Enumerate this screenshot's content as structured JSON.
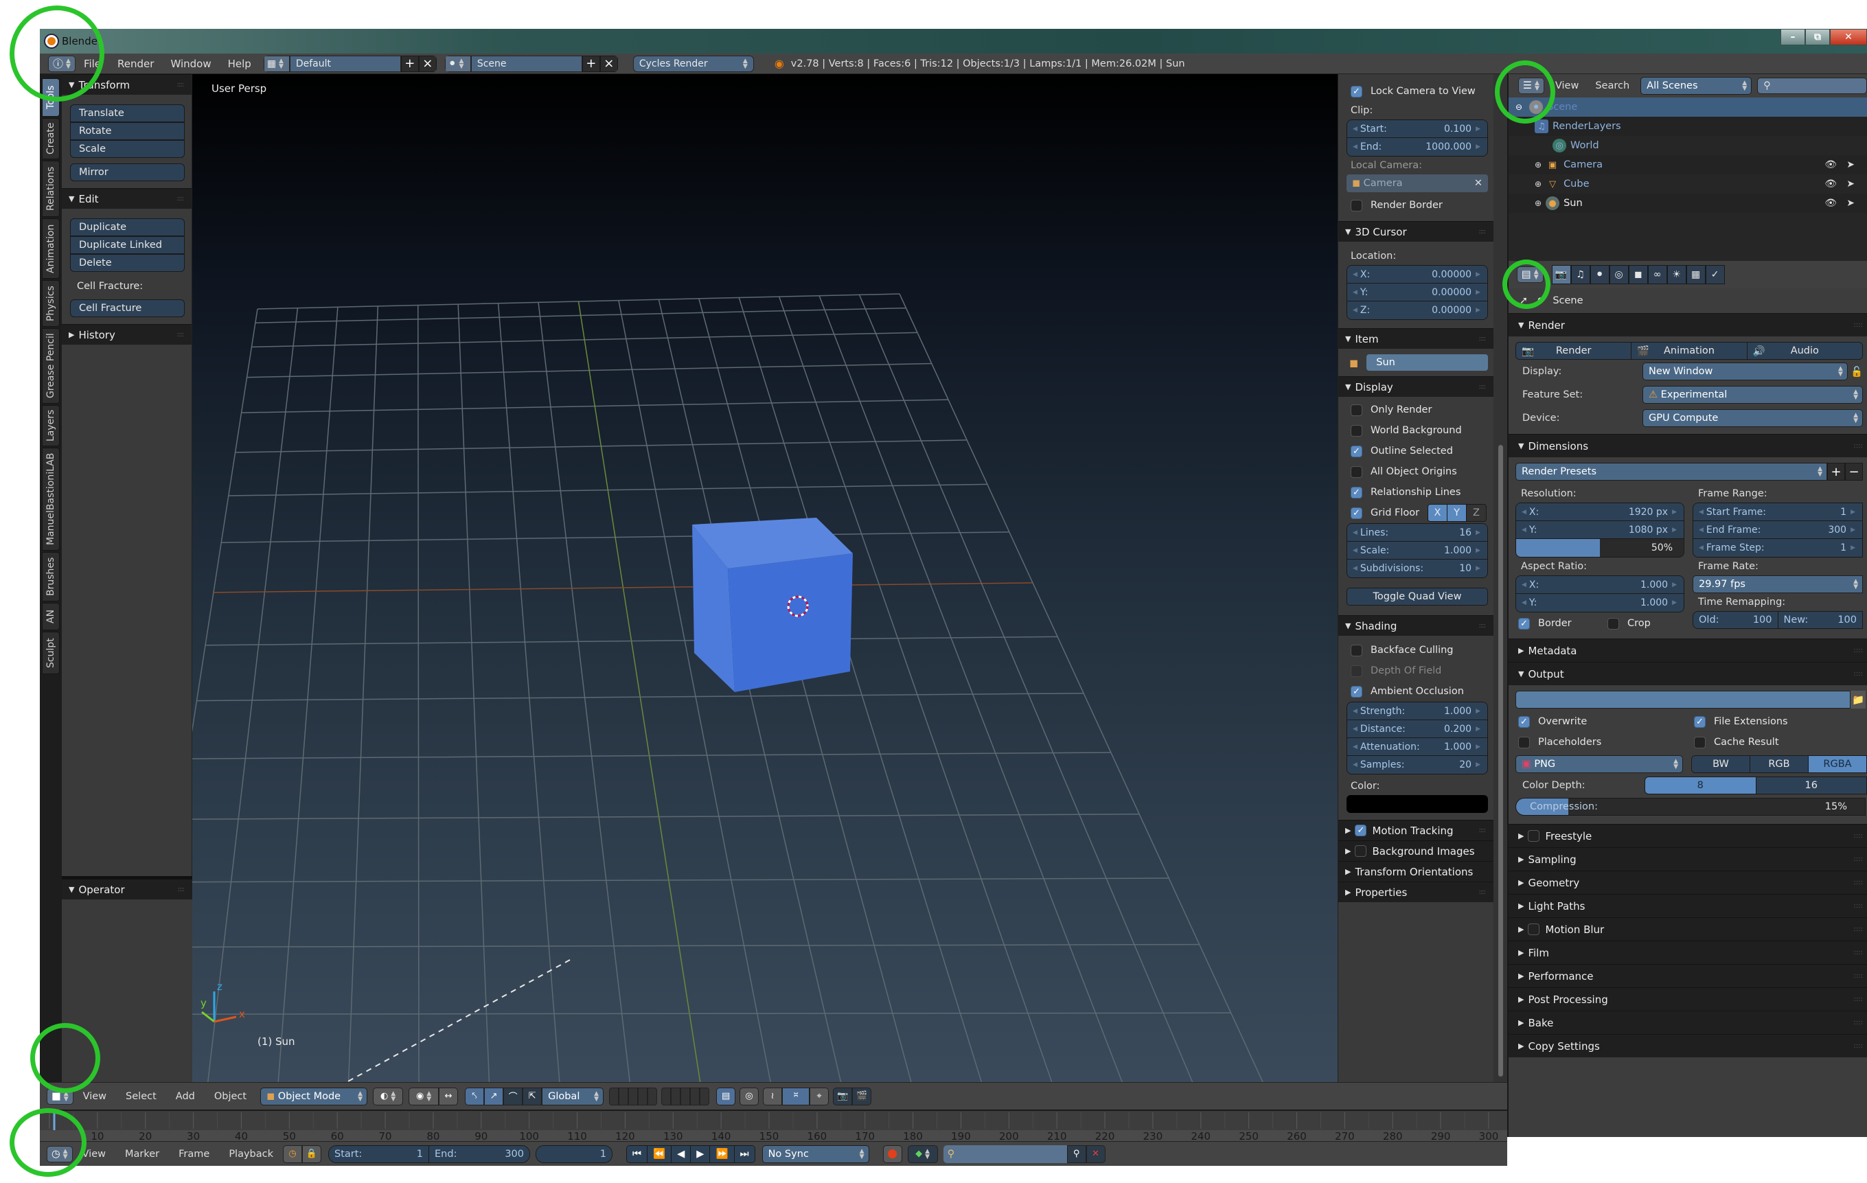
{
  "window": {
    "title": "Blender",
    "controls": [
      "minimize",
      "restore",
      "close"
    ]
  },
  "menubar": {
    "editor_type_icon": "info-icon",
    "menus": [
      "File",
      "Render",
      "Window",
      "Help"
    ],
    "screen_layout": "Default",
    "scene": "Scene",
    "render_engine": "Cycles Render",
    "stats": "v2.78 | Verts:8 | Faces:6 | Tris:12 | Objects:1/3 | Lamps:1/1 | Mem:26.02M | Sun"
  },
  "left_tabs": [
    "Tools",
    "Create",
    "Relations",
    "Animation",
    "Physics",
    "Grease Pencil",
    "Layers",
    "ManuelBastioniLAB",
    "Brushes",
    "AN",
    "Sculpt"
  ],
  "toolbar": {
    "transform": {
      "title": "Transform",
      "buttons": [
        "Translate",
        "Rotate",
        "Scale"
      ],
      "mirror": "Mirror"
    },
    "edit": {
      "title": "Edit",
      "buttons": [
        "Duplicate",
        "Duplicate Linked",
        "Delete"
      ],
      "cell_fracture_label": "Cell Fracture:",
      "cell_fracture_button": "Cell Fracture"
    },
    "history": {
      "title": "History"
    },
    "operator": {
      "title": "Operator"
    }
  },
  "viewport": {
    "view_label": "User Persp",
    "active_object": "(1) Sun",
    "axis_labels": {
      "x": "x",
      "y": "y",
      "z": "z"
    },
    "cube_color": "#4a74d8"
  },
  "npanel": {
    "view": {
      "lock_camera": {
        "label": "Lock Camera to View",
        "checked": true
      },
      "clip_label": "Clip:",
      "clip_start": {
        "label": "Start:",
        "value": "0.100"
      },
      "clip_end": {
        "label": "End:",
        "value": "1000.000"
      },
      "local_camera_label": "Local Camera:",
      "local_camera_value": "Camera",
      "render_border": {
        "label": "Render Border",
        "checked": false
      }
    },
    "cursor": {
      "title": "3D Cursor",
      "location_label": "Location:",
      "x": {
        "label": "X:",
        "value": "0.00000"
      },
      "y": {
        "label": "Y:",
        "value": "0.00000"
      },
      "z": {
        "label": "Z:",
        "value": "0.00000"
      }
    },
    "item": {
      "title": "Item",
      "name": "Sun"
    },
    "display": {
      "title": "Display",
      "only_render": {
        "label": "Only Render",
        "checked": false
      },
      "world_background": {
        "label": "World Background",
        "checked": false
      },
      "outline_selected": {
        "label": "Outline Selected",
        "checked": true
      },
      "all_object_origins": {
        "label": "All Object Origins",
        "checked": false
      },
      "relationship_lines": {
        "label": "Relationship Lines",
        "checked": true
      },
      "grid_floor": {
        "label": "Grid Floor",
        "checked": true,
        "axes": [
          "X",
          "Y",
          "Z"
        ],
        "axes_on": [
          true,
          true,
          false
        ]
      },
      "lines": {
        "label": "Lines:",
        "value": "16"
      },
      "scale": {
        "label": "Scale:",
        "value": "1.000"
      },
      "subdivisions": {
        "label": "Subdivisions:",
        "value": "10"
      },
      "toggle_quad": "Toggle Quad View"
    },
    "shading": {
      "title": "Shading",
      "backface_culling": {
        "label": "Backface Culling",
        "checked": false
      },
      "depth_of_field": {
        "label": "Depth Of Field",
        "checked": false
      },
      "ambient_occlusion": {
        "label": "Ambient Occlusion",
        "checked": true
      },
      "strength": {
        "label": "Strength:",
        "value": "1.000"
      },
      "distance": {
        "label": "Distance:",
        "value": "0.200"
      },
      "attenuation": {
        "label": "Attenuation:",
        "value": "1.000"
      },
      "samples": {
        "label": "Samples:",
        "value": "20"
      },
      "color_label": "Color:",
      "color_value": "#000000"
    },
    "collapsed": [
      {
        "label": "Motion Tracking",
        "checkbox": true,
        "checked": true
      },
      {
        "label": "Background Images",
        "checkbox": true,
        "checked": false
      },
      {
        "label": "Transform Orientations",
        "checkbox": false
      },
      {
        "label": "Properties",
        "checkbox": false
      }
    ]
  },
  "outliner": {
    "menus": [
      "View",
      "Search"
    ],
    "filter": "All Scenes",
    "search_placeholder": "",
    "tree": [
      {
        "name": "Scene",
        "icon": "scene-icon",
        "level": 0,
        "selected": true
      },
      {
        "name": "RenderLayers",
        "icon": "render-layers-icon",
        "level": 1
      },
      {
        "name": "World",
        "icon": "world-icon",
        "level": 1
      },
      {
        "name": "Camera",
        "icon": "camera-icon",
        "level": 1,
        "visible": true
      },
      {
        "name": "Cube",
        "icon": "mesh-icon",
        "level": 1,
        "visible": true
      },
      {
        "name": "Sun",
        "icon": "lamp-icon",
        "level": 1,
        "visible": true
      }
    ]
  },
  "properties": {
    "tabs": [
      "render-icon",
      "render-layers-icon",
      "scene-icon",
      "world-icon",
      "object-icon",
      "constraints-icon",
      "data-icon",
      "texture-icon",
      "modifiers-icon"
    ],
    "context": "Scene",
    "render": {
      "title": "Render",
      "buttons": [
        "Render",
        "Animation",
        "Audio"
      ],
      "display_label": "Display:",
      "display_value": "New Window",
      "feature_set_label": "Feature Set:",
      "feature_set_value": "Experimental",
      "device_label": "Device:",
      "device_value": "GPU Compute"
    },
    "dimensions": {
      "title": "Dimensions",
      "presets": "Render Presets",
      "resolution_label": "Resolution:",
      "res_x": {
        "label": "X:",
        "value": "1920 px"
      },
      "res_y": {
        "label": "Y:",
        "value": "1080 px"
      },
      "res_pct": {
        "value": "50%",
        "fraction": 0.5
      },
      "aspect_label": "Aspect Ratio:",
      "asp_x": {
        "label": "X:",
        "value": "1.000"
      },
      "asp_y": {
        "label": "Y:",
        "value": "1.000"
      },
      "border": {
        "label": "Border",
        "checked": true
      },
      "crop": {
        "label": "Crop",
        "checked": false
      },
      "frame_range_label": "Frame Range:",
      "start_frame": {
        "label": "Start Frame:",
        "value": "1"
      },
      "end_frame": {
        "label": "End Frame:",
        "value": "300"
      },
      "frame_step": {
        "label": "Frame Step:",
        "value": "1"
      },
      "frame_rate_label": "Frame Rate:",
      "frame_rate": "29.97 fps",
      "time_remap_label": "Time Remapping:",
      "old": {
        "label": "Old:",
        "value": "100"
      },
      "new": {
        "label": "New:",
        "value": "100"
      }
    },
    "metadata": {
      "title": "Metadata"
    },
    "output": {
      "title": "Output",
      "path": "",
      "overwrite": {
        "label": "Overwrite",
        "checked": true
      },
      "file_extensions": {
        "label": "File Extensions",
        "checked": true
      },
      "placeholders": {
        "label": "Placeholders",
        "checked": false
      },
      "cache_result": {
        "label": "Cache Result",
        "checked": false
      },
      "format": "PNG",
      "color_modes": [
        "BW",
        "RGB",
        "RGBA"
      ],
      "color_mode_selected": "RGBA",
      "color_depth_label": "Color Depth:",
      "color_depths": [
        "8",
        "16"
      ],
      "color_depth_selected": "8",
      "compression": {
        "label": "Compression:",
        "value": "15%",
        "fraction": 0.15
      }
    },
    "collapsed": [
      {
        "label": "Freestyle",
        "checkbox": true,
        "checked": false
      },
      {
        "label": "Sampling",
        "checkbox": false
      },
      {
        "label": "Geometry",
        "checkbox": false
      },
      {
        "label": "Light Paths",
        "checkbox": false
      },
      {
        "label": "Motion Blur",
        "checkbox": true,
        "checked": false
      },
      {
        "label": "Film",
        "checkbox": false
      },
      {
        "label": "Performance",
        "checkbox": false
      },
      {
        "label": "Post Processing",
        "checkbox": false
      },
      {
        "label": "Bake",
        "checkbox": false
      },
      {
        "label": "Copy Settings",
        "checkbox": false
      }
    ]
  },
  "view3d_header": {
    "menus": [
      "View",
      "Select",
      "Add",
      "Object"
    ],
    "mode": "Object Mode",
    "orientation": "Global"
  },
  "timeline": {
    "ticks": [
      "10",
      "20",
      "30",
      "40",
      "50",
      "60",
      "70",
      "80",
      "90",
      "100",
      "110",
      "120",
      "130",
      "140",
      "150",
      "160",
      "170",
      "180",
      "190",
      "200",
      "210",
      "220",
      "230",
      "240",
      "250",
      "260",
      "270",
      "280",
      "290",
      "300"
    ],
    "menus": [
      "View",
      "Marker",
      "Frame",
      "Playback"
    ],
    "start": {
      "label": "Start:",
      "value": "1"
    },
    "end": {
      "label": "End:",
      "value": "300"
    },
    "current": "1",
    "sync": "No Sync"
  }
}
